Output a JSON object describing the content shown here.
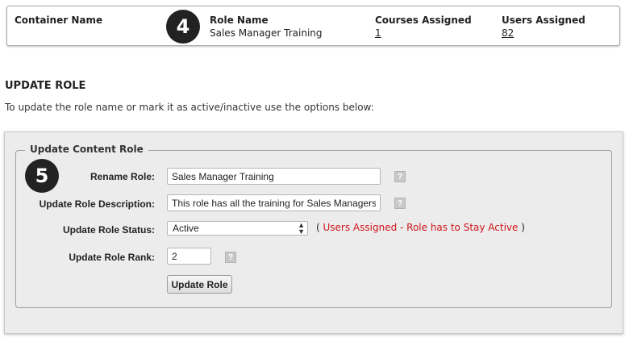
{
  "summary": {
    "container_name_header": "Container Name",
    "role_name_header": "Role Name",
    "role_name_value": "Sales Manager Training",
    "courses_assigned_header": "Courses Assigned",
    "courses_assigned_value": "1",
    "users_assigned_header": "Users Assigned",
    "users_assigned_value": "82"
  },
  "badges": {
    "step4": "4",
    "step5": "5"
  },
  "section": {
    "title": "UPDATE ROLE",
    "description": "To update the role name or mark it as active/inactive use the options below:"
  },
  "form": {
    "legend": "Update Content Role",
    "rename_label": "Rename Role:",
    "rename_value": "Sales Manager Training",
    "description_label": "Update Role Description:",
    "description_value": "This role has all the training for Sales Managers",
    "status_label": "Update Role Status:",
    "status_value": "Active",
    "status_note_open": "( ",
    "status_note_text": "Users Assigned - Role has to Stay Active",
    "status_note_close": " )",
    "rank_label": "Update Role Rank:",
    "rank_value": "2",
    "help_glyph": "?",
    "submit_label": "Update Role"
  },
  "colors": {
    "panel_bg": "#ececec",
    "warning_red": "#d0151a",
    "badge_bg": "#222222"
  }
}
